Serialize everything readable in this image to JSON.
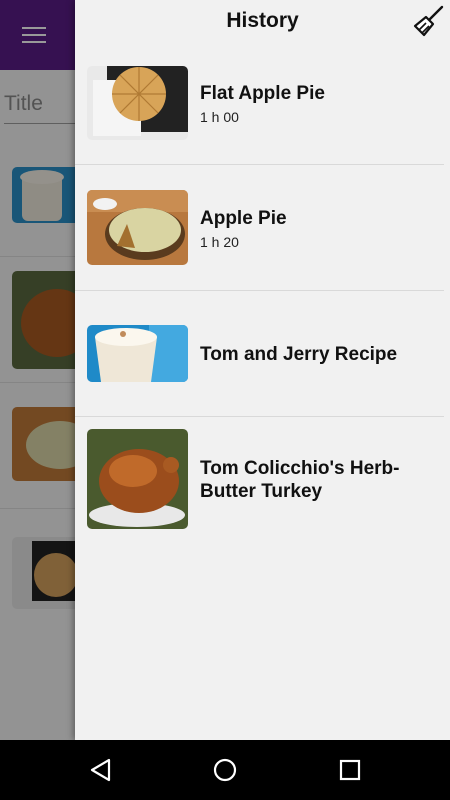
{
  "background": {
    "search_placeholder": "Title"
  },
  "drawer": {
    "title": "History",
    "clear_icon": "broom-icon",
    "items": [
      {
        "name": "Flat Apple Pie",
        "time": "1 h 00"
      },
      {
        "name": "Apple Pie",
        "time": "1 h 20"
      },
      {
        "name": "Tom and Jerry Recipe",
        "time": ""
      },
      {
        "name": "Tom Colicchio's Herb-Butter Turkey",
        "time": ""
      }
    ]
  },
  "navbar": {
    "back_icon": "back-triangle-icon",
    "home_icon": "home-circle-icon",
    "recent_icon": "recent-square-icon"
  },
  "colors": {
    "app_bar": "#5b1d87",
    "drawer_bg": "#f1f1f1",
    "nav_bar": "#000000"
  }
}
